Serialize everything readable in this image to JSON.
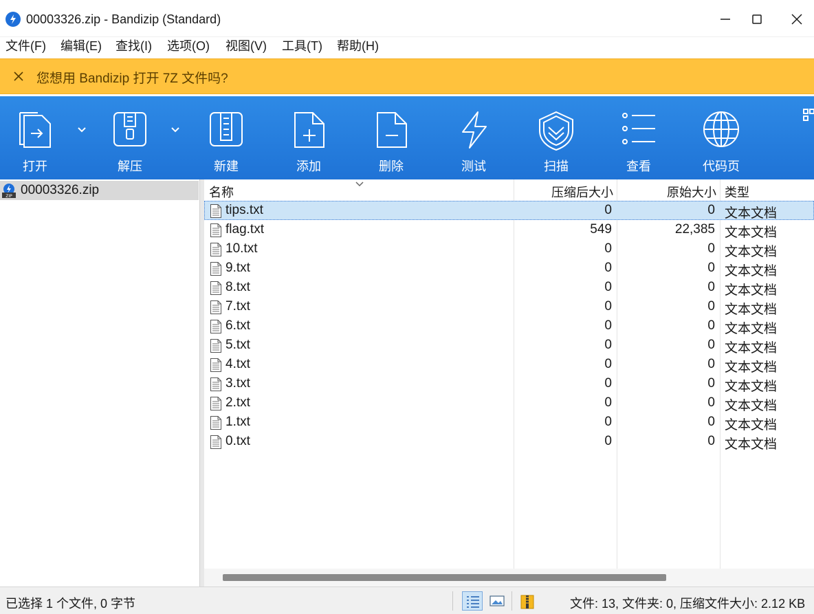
{
  "window": {
    "title": "00003326.zip - Bandizip (Standard)",
    "accent": "#1f73d6"
  },
  "menu": [
    "文件(F)",
    "编辑(E)",
    "查找(I)",
    "选项(O)",
    "视图(V)",
    "工具(T)",
    "帮助(H)"
  ],
  "notification": {
    "message": "您想用 Bandizip 打开 7Z 文件吗?",
    "color": "#ffc23d"
  },
  "toolbar": {
    "open": "打开",
    "extract": "解压",
    "new": "新建",
    "add": "添加",
    "delete": "删除",
    "test": "测试",
    "scan": "扫描",
    "view": "查看",
    "codepage": "代码页"
  },
  "tree": {
    "archive": "00003326.zip"
  },
  "columns": {
    "name": "名称",
    "compressed": "压缩后大小",
    "original": "原始大小",
    "type": "类型"
  },
  "files": [
    {
      "name": "tips.txt",
      "compressed": "0",
      "original": "0",
      "type": "文本文档"
    },
    {
      "name": "flag.txt",
      "compressed": "549",
      "original": "22,385",
      "type": "文本文档"
    },
    {
      "name": "10.txt",
      "compressed": "0",
      "original": "0",
      "type": "文本文档"
    },
    {
      "name": "9.txt",
      "compressed": "0",
      "original": "0",
      "type": "文本文档"
    },
    {
      "name": "8.txt",
      "compressed": "0",
      "original": "0",
      "type": "文本文档"
    },
    {
      "name": "7.txt",
      "compressed": "0",
      "original": "0",
      "type": "文本文档"
    },
    {
      "name": "6.txt",
      "compressed": "0",
      "original": "0",
      "type": "文本文档"
    },
    {
      "name": "5.txt",
      "compressed": "0",
      "original": "0",
      "type": "文本文档"
    },
    {
      "name": "4.txt",
      "compressed": "0",
      "original": "0",
      "type": "文本文档"
    },
    {
      "name": "3.txt",
      "compressed": "0",
      "original": "0",
      "type": "文本文档"
    },
    {
      "name": "2.txt",
      "compressed": "0",
      "original": "0",
      "type": "文本文档"
    },
    {
      "name": "1.txt",
      "compressed": "0",
      "original": "0",
      "type": "文本文档"
    },
    {
      "name": "0.txt",
      "compressed": "0",
      "original": "0",
      "type": "文本文档"
    }
  ],
  "status": {
    "selection": "已选择 1 个文件, 0 字节",
    "summary": "文件: 13, 文件夹: 0, 压缩文件大小: 2.12 KB"
  }
}
